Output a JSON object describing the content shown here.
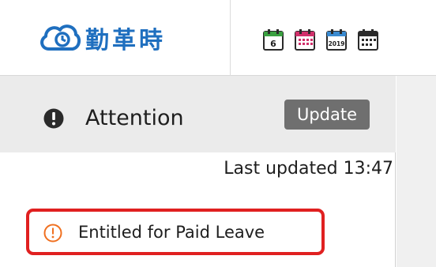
{
  "app": {
    "logo_text": "勤革時",
    "logo_icon": "cloud-clock-icon",
    "brand_color": "#1f6fbf"
  },
  "toolbar": {
    "icons": [
      {
        "name": "calendar-day-icon",
        "label": "6"
      },
      {
        "name": "calendar-month-icon",
        "label": ""
      },
      {
        "name": "calendar-year-icon",
        "label": "2019"
      },
      {
        "name": "calendar-grid-icon",
        "label": ""
      }
    ]
  },
  "attention": {
    "title": "Attention",
    "icon": "exclamation-circle-icon",
    "update_label": "Update",
    "last_updated": "Last updated 13:47",
    "alerts": [
      {
        "label": "Entitled for Paid Leave",
        "icon": "warning-circle-icon",
        "color": "#f07020"
      }
    ],
    "highlight_color": "#e02020"
  }
}
